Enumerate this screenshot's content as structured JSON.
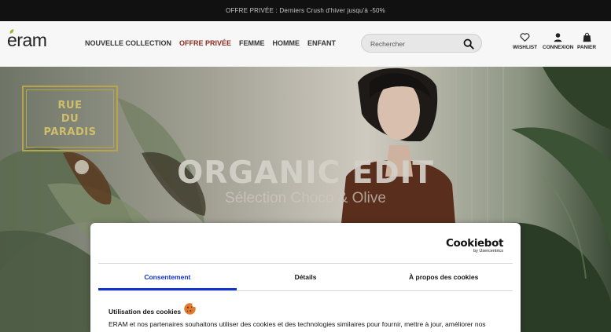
{
  "promo_bar": {
    "text": "OFFRE PRIVÉE : Derniers Crush d'hiver jusqu'à -50%"
  },
  "header": {
    "logo": "eram",
    "nav": [
      {
        "label": "NOUVELLE COLLECTION"
      },
      {
        "label": "OFFRE PRIVÉE"
      },
      {
        "label": "FEMME"
      },
      {
        "label": "HOMME"
      },
      {
        "label": "ENFANT"
      }
    ],
    "search": {
      "placeholder": "Rechercher"
    },
    "utilities": [
      {
        "label": "WISHLIST",
        "icon": "heart-icon"
      },
      {
        "label": "CONNEXION",
        "icon": "user-icon"
      },
      {
        "label": "PANIER",
        "icon": "bag-icon"
      }
    ]
  },
  "hero": {
    "badge": [
      "RUE",
      "DU",
      "PARADIS"
    ],
    "title": "ORGANIC EDIT",
    "subtitle": "Sélection Choco & Olive"
  },
  "cookie_banner": {
    "brand": "Cookiebot",
    "brand_by": "by Usercentrics",
    "tabs": [
      {
        "label": "Consentement",
        "active": true
      },
      {
        "label": "Détails",
        "active": false
      },
      {
        "label": "À propos des cookies",
        "active": false
      }
    ],
    "section_title": "Utilisation des cookies",
    "text": "ERAM et nos partenaires souhaitons utiliser des cookies et des technologies similaires pour fournir, mettre à jour, améliorer nos"
  },
  "colors": {
    "accent": "#1032cf",
    "promo": "#8a2b1c",
    "badge_gold": "#b8a54a"
  }
}
